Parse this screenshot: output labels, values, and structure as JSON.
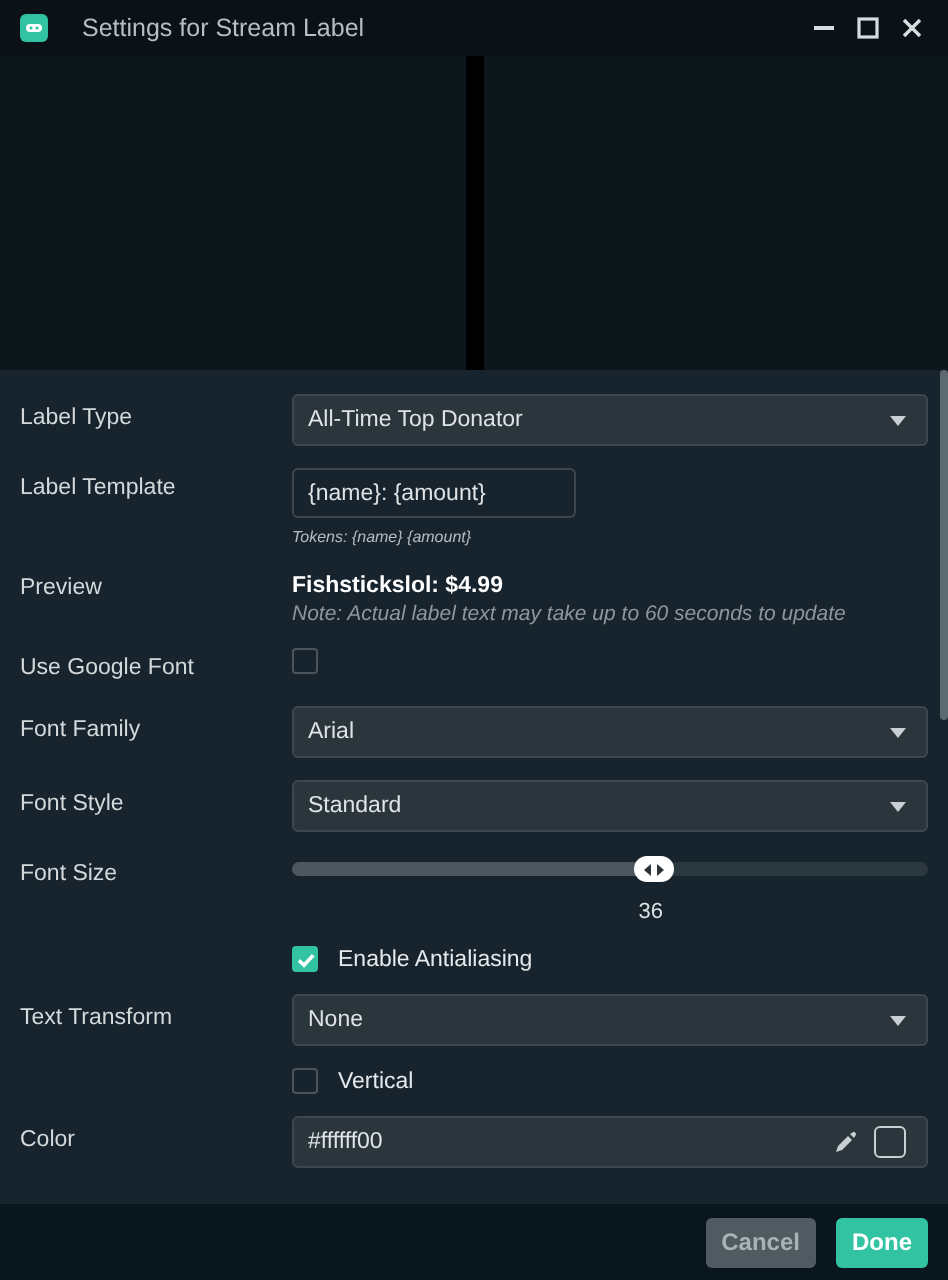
{
  "window": {
    "title": "Settings for Stream Label"
  },
  "fields": [
    {
      "kind": "select",
      "label": "Label Type",
      "value": "All-Time Top Donator"
    },
    {
      "kind": "text",
      "label": "Label Template",
      "value": "{name}: {amount}",
      "hint": "Tokens: {name} {amount}"
    },
    {
      "kind": "preview",
      "label": "Preview",
      "value": "Fishstickslol: $4.99",
      "note": "Note: Actual label text may take up to 60 seconds to update"
    },
    {
      "kind": "checkbox",
      "label": "Use Google Font",
      "checked": false
    },
    {
      "kind": "select",
      "label": "Font Family",
      "value": "Arial"
    },
    {
      "kind": "select",
      "label": "Font Style",
      "value": "Standard"
    },
    {
      "kind": "slider",
      "label": "Font Size",
      "level": 0.57,
      "reading": "36"
    },
    {
      "kind": "checkbox",
      "caption": "Enable Antialiasing",
      "checked": true
    },
    {
      "kind": "select",
      "label": "Text Transform",
      "value": "None"
    },
    {
      "kind": "checkbox",
      "caption": "Vertical",
      "checked": false
    },
    {
      "kind": "color",
      "label": "Color",
      "value": "#ffffff00"
    }
  ],
  "buttons": [
    {
      "label": "Cancel",
      "kind": "secondary"
    },
    {
      "label": "Done",
      "kind": "primary"
    }
  ]
}
